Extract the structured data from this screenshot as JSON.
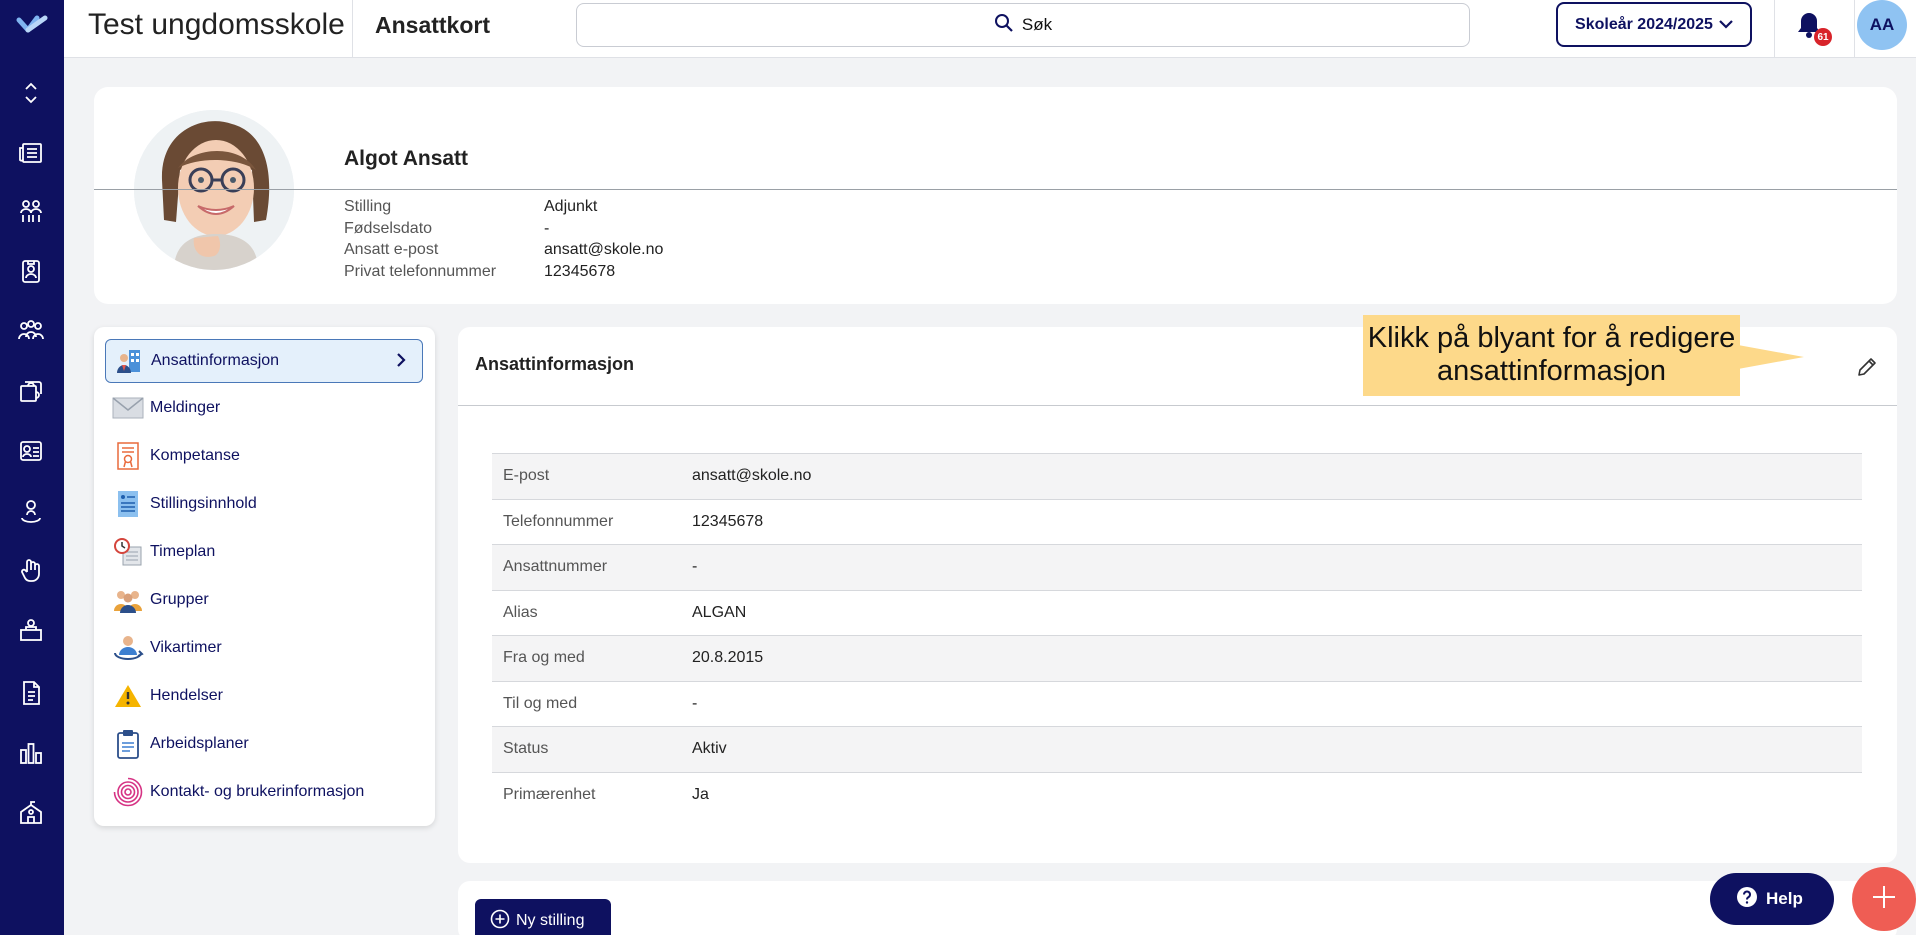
{
  "header": {
    "school_name": "Test ungdomsskole",
    "page_title": "Ansattkort",
    "search_label": "Søk",
    "school_year": "Skoleår 2024/2025",
    "notification_count": "61",
    "user_initials": "AA"
  },
  "profile": {
    "name": "Algot Ansatt",
    "fields": [
      {
        "label": "Stilling",
        "value": "Adjunkt"
      },
      {
        "label": "Fødselsdato",
        "value": "-"
      },
      {
        "label": "Ansatt e-post",
        "value": "ansatt@skole.no"
      },
      {
        "label": "Privat telefonnummer",
        "value": "12345678"
      }
    ]
  },
  "menu": {
    "items": [
      {
        "label": "Ansattinformasjon",
        "icon": "employee-info-icon",
        "active": true
      },
      {
        "label": "Meldinger",
        "icon": "envelope-icon"
      },
      {
        "label": "Kompetanse",
        "icon": "certificate-icon"
      },
      {
        "label": "Stillingsinnhold",
        "icon": "job-content-icon"
      },
      {
        "label": "Timeplan",
        "icon": "clock-calendar-icon"
      },
      {
        "label": "Grupper",
        "icon": "group-icon"
      },
      {
        "label": "Vikartimer",
        "icon": "substitute-icon"
      },
      {
        "label": "Hendelser",
        "icon": "warning-icon"
      },
      {
        "label": "Arbeidsplaner",
        "icon": "clipboard-icon"
      },
      {
        "label": "Kontakt- og brukerinformasjon",
        "icon": "fingerprint-icon"
      }
    ]
  },
  "main": {
    "title": "Ansattinformasjon",
    "tooltip_line1": "Klikk på blyant for å redigere",
    "tooltip_line2": "ansattinformasjon",
    "rows": [
      {
        "label": "E-post",
        "value": "ansatt@skole.no"
      },
      {
        "label": "Telefonnummer",
        "value": "12345678"
      },
      {
        "label": "Ansattnummer",
        "value": "-"
      },
      {
        "label": "Alias",
        "value": "ALGAN"
      },
      {
        "label": "Fra og med",
        "value": "20.8.2015"
      },
      {
        "label": "Til og med",
        "value": "-"
      },
      {
        "label": "Status",
        "value": "Aktiv"
      },
      {
        "label": "Primærenhet",
        "value": "Ja"
      }
    ]
  },
  "actions": {
    "new_position": "Ny stilling",
    "help": "Help"
  },
  "colors": {
    "navy": "#0e1160",
    "accent_coral": "#ef5d54",
    "tooltip_yellow": "#fdd98a"
  }
}
